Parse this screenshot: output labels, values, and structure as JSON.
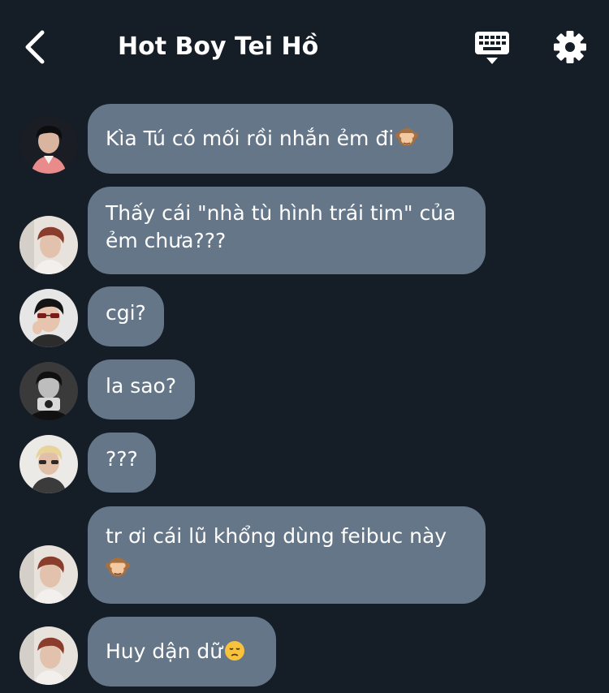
{
  "header": {
    "title": "Hot Boy Tei Hồ",
    "back_icon": "chevron-left-icon",
    "keyboard_icon": "keyboard-icon",
    "settings_icon": "gear-icon"
  },
  "colors": {
    "background": "#151d26",
    "bubble": "#657688",
    "text": "#ffffff"
  },
  "messages": [
    {
      "text": "Kìa Tú có mối rồi nhắn ẻm đi",
      "emoji": "monkey-see-no-evil"
    },
    {
      "text": "Thấy cái \"nhà tù hình trái tim\" của ẻm chưa???"
    },
    {
      "text": "cgi?"
    },
    {
      "text": "la sao?"
    },
    {
      "text": "???"
    },
    {
      "text": "tr ơi cái lũ khổng dùng feibuc này",
      "emoji": "monkey-see-no-evil"
    },
    {
      "text": "Huy dận dữ",
      "emoji": "disappointed-face"
    }
  ]
}
